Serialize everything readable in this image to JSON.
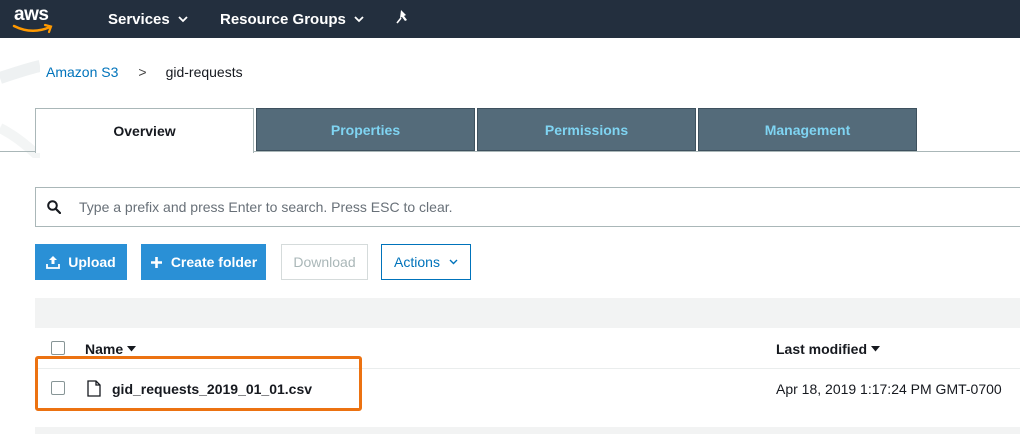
{
  "nav": {
    "logo_text": "aws",
    "services_label": "Services",
    "resource_groups_label": "Resource Groups"
  },
  "breadcrumb": {
    "root": "Amazon S3",
    "separator": ">",
    "current": "gid-requests"
  },
  "tabs": [
    {
      "label": "Overview",
      "active": true
    },
    {
      "label": "Properties",
      "active": false
    },
    {
      "label": "Permissions",
      "active": false
    },
    {
      "label": "Management",
      "active": false
    }
  ],
  "search": {
    "placeholder": "Type a prefix and press Enter to search. Press ESC to clear.",
    "value": ""
  },
  "toolbar": {
    "upload_label": "Upload",
    "create_folder_label": "Create folder",
    "download_label": "Download",
    "actions_label": "Actions"
  },
  "table": {
    "columns": [
      "Name",
      "Last modified"
    ],
    "rows": [
      {
        "name": "gid_requests_2019_01_01.csv",
        "last_modified": "Apr 18, 2019 1:17:24 PM GMT-0700"
      }
    ]
  },
  "icons": {
    "search": "search-icon",
    "upload": "upload-icon",
    "create": "plus-icon",
    "file": "file-icon",
    "pin": "pin-icon"
  },
  "colors": {
    "nav_bg": "#232f3e",
    "tab_inactive_bg": "#546b7a",
    "tab_inactive_text": "#7fd4f2",
    "primary_button": "#2a90d6",
    "link": "#0073bb",
    "highlight": "#ec7211"
  }
}
